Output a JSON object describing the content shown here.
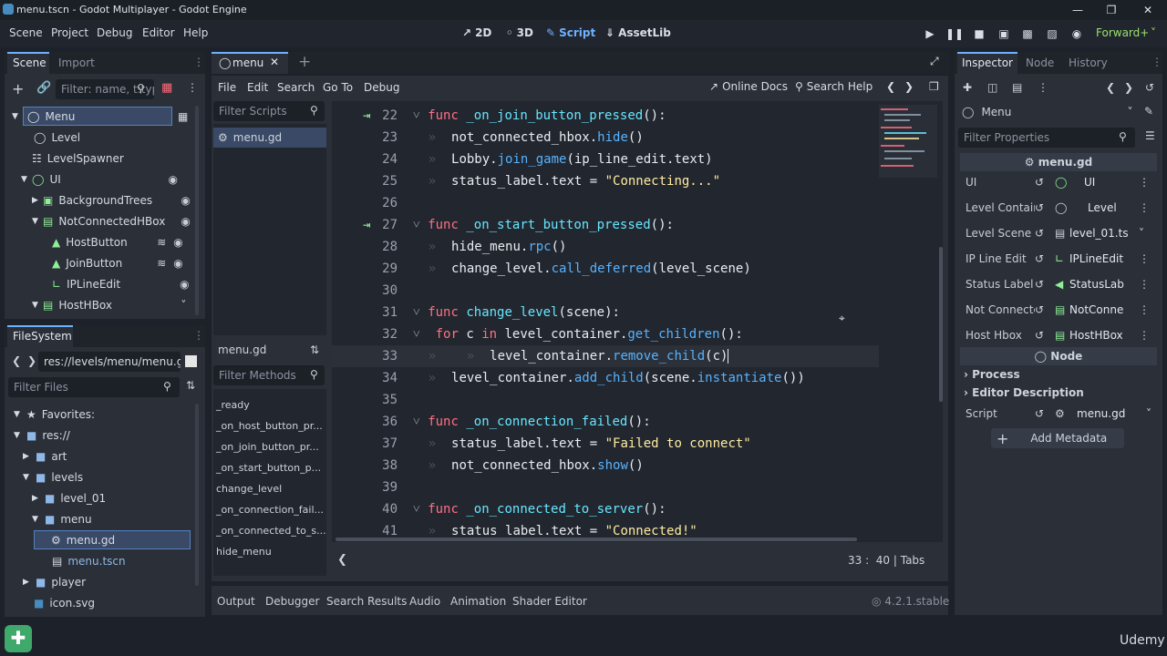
{
  "window": {
    "title": "menu.tscn - Godot Multiplayer - Godot Engine"
  },
  "menu": {
    "scene": "Scene",
    "project": "Project",
    "debug": "Debug",
    "editor": "Editor",
    "help": "Help"
  },
  "workspaces": {
    "w2d": "2D",
    "w3d": "3D",
    "script": "Script",
    "assetlib": "AssetLib"
  },
  "renderer": "Forward+",
  "scene_dock": {
    "tab_scene": "Scene",
    "tab_import": "Import",
    "filter_placeholder": "Filter: name, t:type",
    "nodes": [
      {
        "label": "Menu"
      },
      {
        "label": "Level"
      },
      {
        "label": "LevelSpawner"
      },
      {
        "label": "UI"
      },
      {
        "label": "BackgroundTrees"
      },
      {
        "label": "NotConnectedHBox"
      },
      {
        "label": "HostButton"
      },
      {
        "label": "JoinButton"
      },
      {
        "label": "IPLineEdit"
      },
      {
        "label": "HostHBox"
      }
    ]
  },
  "filesystem": {
    "title": "FileSystem",
    "path": "res://levels/menu/menu.gd",
    "filter_placeholder": "Filter Files",
    "items": [
      {
        "label": "Favorites:"
      },
      {
        "label": "res://"
      },
      {
        "label": "art"
      },
      {
        "label": "levels"
      },
      {
        "label": "level_01"
      },
      {
        "label": "menu"
      },
      {
        "label": "menu.gd"
      },
      {
        "label": "menu.tscn"
      },
      {
        "label": "player"
      },
      {
        "label": "icon.svg"
      }
    ]
  },
  "script_editor": {
    "tab": "menu",
    "menu": {
      "file": "File",
      "edit": "Edit",
      "search": "Search",
      "goto": "Go To",
      "debug": "Debug"
    },
    "online_docs": "Online Docs",
    "search_help": "Search Help",
    "filter_scripts": "Filter Scripts",
    "scripts": [
      "menu.gd"
    ],
    "current_script": "menu.gd",
    "filter_methods": "Filter Methods",
    "methods": [
      "_ready",
      "_on_host_button_pr...",
      "_on_join_button_pr...",
      "_on_start_button_p...",
      "change_level",
      "_on_connection_fail...",
      "_on_connected_to_s...",
      "hide_menu"
    ],
    "status": {
      "line": "33",
      "col": "40",
      "indent": "Tabs"
    }
  },
  "code": [
    {
      "n": "22"
    },
    {
      "n": "23"
    },
    {
      "n": "24"
    },
    {
      "n": "25"
    },
    {
      "n": "26"
    },
    {
      "n": "27"
    },
    {
      "n": "28"
    },
    {
      "n": "29"
    },
    {
      "n": "30"
    },
    {
      "n": "31"
    },
    {
      "n": "32"
    },
    {
      "n": "33"
    },
    {
      "n": "34"
    },
    {
      "n": "35"
    },
    {
      "n": "36"
    },
    {
      "n": "37"
    },
    {
      "n": "38"
    },
    {
      "n": "39"
    },
    {
      "n": "40"
    },
    {
      "n": "41"
    }
  ],
  "code_tokens": {
    "func": "func",
    "for": "for",
    "in": "in",
    "l22": "_on_join_button_pressed",
    "l22e": "():",
    "l23a": "not_connected_hbox.",
    "l23b": "hide",
    "l23c": "()",
    "l24a": "Lobby.",
    "l24b": "join_game",
    "l24c": "(ip_line_edit.text)",
    "l25a": "status_label.text = ",
    "l25b": "\"Connecting...\"",
    "l27": "_on_start_button_pressed",
    "l27e": "():",
    "l28a": "hide_menu.",
    "l28b": "rpc",
    "l28c": "()",
    "l29a": "change_level.",
    "l29b": "call_deferred",
    "l29c": "(level_scene)",
    "l31": "change_level",
    "l31e": "(scene):",
    "l32a": " c ",
    "l32b": " level_container.",
    "l32c": "get_children",
    "l32d": "():",
    "l33a": "level_container.",
    "l33b": "remove_child",
    "l33c": "(c)",
    "l34a": "level_container.",
    "l34b": "add_child",
    "l34c": "(scene.",
    "l34d": "instantiate",
    "l34e": "())",
    "l36": "_on_connection_failed",
    "l36e": "():",
    "l37a": "status_label.text = ",
    "l37b": "\"Failed to connect\"",
    "l38a": "not_connected_hbox.",
    "l38b": "show",
    "l38c": "()",
    "l40": "_on_connected_to_server",
    "l40e": "():",
    "l41a": "status_label.text = ",
    "l41b": "\"Connected!\""
  },
  "bottom_panel": {
    "output": "Output",
    "debugger": "Debugger",
    "search_results": "Search Results",
    "audio": "Audio",
    "animation": "Animation",
    "shader_editor": "Shader Editor",
    "version": "4.2.1.stable"
  },
  "inspector": {
    "tab_inspector": "Inspector",
    "tab_node": "Node",
    "tab_history": "History",
    "object": "Menu",
    "filter_placeholder": "Filter Properties",
    "script_header": "menu.gd",
    "props": [
      {
        "k": "UI",
        "v": "UI"
      },
      {
        "k": "Level Container",
        "v": "Level"
      },
      {
        "k": "Level Scene",
        "v": "level_01.ts"
      },
      {
        "k": "IP Line Edit",
        "v": "IPLineEdit"
      },
      {
        "k": "Status Label",
        "v": "StatusLab"
      },
      {
        "k": "Not Connecte...",
        "v": "NotConne"
      },
      {
        "k": "Host Hbox",
        "v": "HostHBox"
      }
    ],
    "node_header": "Node",
    "process": "Process",
    "editor_description": "Editor Description",
    "script_key": "Script",
    "script_value": "menu.gd",
    "add_metadata": "Add Metadata"
  },
  "watermark": "Udemy"
}
